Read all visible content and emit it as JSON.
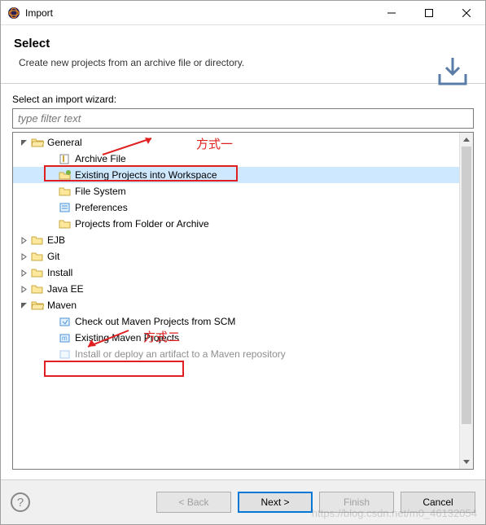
{
  "window": {
    "title": "Import"
  },
  "header": {
    "title": "Select",
    "description": "Create new projects from an archive file or directory."
  },
  "content": {
    "wizard_label": "Select an import wizard:",
    "filter_placeholder": "type filter text"
  },
  "tree": {
    "general": {
      "label": "General"
    },
    "archive_file": {
      "label": "Archive File"
    },
    "existing_projects": {
      "label": "Existing Projects into Workspace"
    },
    "file_system": {
      "label": "File System"
    },
    "preferences": {
      "label": "Preferences"
    },
    "projects_folder": {
      "label": "Projects from Folder or Archive"
    },
    "ejb": {
      "label": "EJB"
    },
    "git": {
      "label": "Git"
    },
    "install": {
      "label": "Install"
    },
    "javaee": {
      "label": "Java EE"
    },
    "maven": {
      "label": "Maven"
    },
    "maven_scm": {
      "label": "Check out Maven Projects from SCM"
    },
    "maven_existing": {
      "label": "Existing Maven Projects"
    },
    "maven_install": {
      "label": "Install or deploy an artifact to a Maven repository"
    }
  },
  "annotations": {
    "method1": "方式一",
    "method2": "方式二"
  },
  "buttons": {
    "back": "< Back",
    "next": "Next >",
    "finish": "Finish",
    "cancel": "Cancel"
  },
  "watermark": "https://blog.csdn.net/m0_46132054"
}
